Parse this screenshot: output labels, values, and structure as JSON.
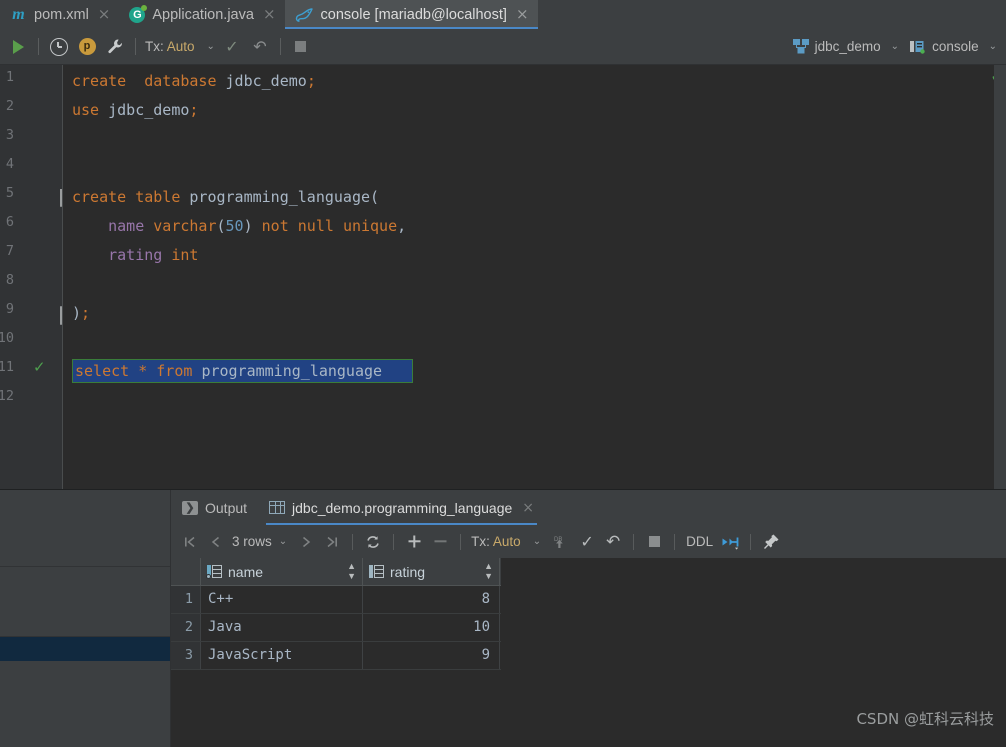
{
  "tabs": [
    {
      "label": "pom.xml",
      "icon": "maven-icon",
      "active": false,
      "close": "×"
    },
    {
      "label": "Application.java",
      "icon": "spring-boot-icon",
      "active": false,
      "close": "×"
    },
    {
      "label": "console [mariadb@localhost]",
      "icon": "mariadb-dolphin-icon",
      "active": true,
      "close": "×"
    }
  ],
  "toolbar": {
    "run_icon": "run-play-icon",
    "history_icon": "clock-history-icon",
    "profile_icon": "parameters-badge-icon",
    "settings_icon": "wrench-icon",
    "tx_prefix": "Tx:",
    "tx_value": "Auto",
    "tx_chevron": "⌄",
    "commit_icon": "commit-check-icon",
    "rollback_icon": "rollback-arrow-icon",
    "stop_icon": "stop-square-icon",
    "datasource": "jdbc_demo",
    "datasource_icon": "database-schema-icon",
    "datasource_chevron": "⌄",
    "session": "console",
    "session_icon": "console-session-icon",
    "session_chevron": "⌄"
  },
  "editor": {
    "right_marker_icon": "inspection-ok-check-icon",
    "line_numbers": [
      "1",
      "2",
      "3",
      "4",
      "5",
      "6",
      "7",
      "8",
      "9",
      "10",
      "11",
      "12"
    ],
    "gutter_check_icon": "statement-ok-check-icon",
    "lines": [
      {
        "n": 1,
        "segments": [
          {
            "t": "create",
            "c": "kw"
          },
          {
            "t": "  ",
            "c": "punc"
          },
          {
            "t": "database",
            "c": "kw"
          },
          {
            "t": " ",
            "c": "punc"
          },
          {
            "t": "jdbc_demo",
            "c": "ident"
          },
          {
            "t": ";",
            "c": "kw"
          }
        ]
      },
      {
        "n": 2,
        "segments": [
          {
            "t": "use",
            "c": "kw"
          },
          {
            "t": " ",
            "c": "punc"
          },
          {
            "t": "jdbc_demo",
            "c": "ident"
          },
          {
            "t": ";",
            "c": "kw"
          }
        ]
      },
      {
        "n": 3,
        "segments": []
      },
      {
        "n": 4,
        "segments": []
      },
      {
        "n": 5,
        "segments": [
          {
            "t": "create",
            "c": "kw"
          },
          {
            "t": " ",
            "c": "punc"
          },
          {
            "t": "table",
            "c": "kw"
          },
          {
            "t": " ",
            "c": "punc"
          },
          {
            "t": "programming_language",
            "c": "ident"
          },
          {
            "t": "(",
            "c": "punc"
          }
        ]
      },
      {
        "n": 6,
        "segments": [
          {
            "t": "    ",
            "c": "punc"
          },
          {
            "t": "name",
            "c": "fld"
          },
          {
            "t": " ",
            "c": "punc"
          },
          {
            "t": "varchar",
            "c": "kw"
          },
          {
            "t": "(",
            "c": "punc"
          },
          {
            "t": "50",
            "c": "num"
          },
          {
            "t": ")",
            "c": "punc"
          },
          {
            "t": " ",
            "c": "punc"
          },
          {
            "t": "not",
            "c": "kw"
          },
          {
            "t": " ",
            "c": "punc"
          },
          {
            "t": "null",
            "c": "kw"
          },
          {
            "t": " ",
            "c": "punc"
          },
          {
            "t": "unique",
            "c": "kw"
          },
          {
            "t": ",",
            "c": "punc"
          }
        ]
      },
      {
        "n": 7,
        "segments": [
          {
            "t": "    ",
            "c": "punc"
          },
          {
            "t": "rating",
            "c": "fld"
          },
          {
            "t": " ",
            "c": "punc"
          },
          {
            "t": "int",
            "c": "kw"
          }
        ]
      },
      {
        "n": 8,
        "segments": []
      },
      {
        "n": 9,
        "segments": [
          {
            "t": ")",
            "c": "punc"
          },
          {
            "t": ";",
            "c": "kw"
          }
        ]
      },
      {
        "n": 10,
        "segments": []
      },
      {
        "n": 11,
        "segments": []
      },
      {
        "n": 12,
        "segments": []
      }
    ],
    "selected_statement": [
      {
        "t": "select",
        "c": "kw"
      },
      {
        "t": " ",
        "c": "punc"
      },
      {
        "t": "*",
        "c": "kw"
      },
      {
        "t": " ",
        "c": "punc"
      },
      {
        "t": "from",
        "c": "kw"
      },
      {
        "t": " ",
        "c": "punc"
      },
      {
        "t": "programming_language",
        "c": "ident"
      }
    ],
    "fold_markers": [
      {
        "line": 5,
        "type": "fold-expanded-open"
      },
      {
        "line": 9,
        "type": "fold-expanded-close"
      }
    ]
  },
  "results": {
    "tabs": [
      {
        "label": "Output",
        "icon": "output-console-icon",
        "active": false,
        "closable": false
      },
      {
        "label": "jdbc_demo.programming_language",
        "icon": "result-grid-icon",
        "active": true,
        "closable": true,
        "close": "×"
      }
    ],
    "toolbar": {
      "first_page_icon": "first-page-icon",
      "prev_page_icon": "prev-page-icon",
      "rows_label": "3 rows",
      "rows_chevron": "⌄",
      "next_page_icon": "next-page-icon",
      "last_page_icon": "last-page-icon",
      "reload_icon": "refresh-icon",
      "add_row_icon": "add-row-icon",
      "delete_row_icon": "delete-row-icon",
      "tx_prefix": "Tx:",
      "tx_value": "Auto",
      "tx_chevron": "⌄",
      "db_upload_icon": "db-submit-icon",
      "commit_icon": "commit-check-icon",
      "rollback_icon": "rollback-arrow-icon",
      "stop_icon": "stop-square-icon",
      "ddl_label": "DDL",
      "export_icon": "export-data-icon",
      "pin_icon": "pin-tab-icon"
    },
    "grid": {
      "columns": [
        {
          "label": "name",
          "icon": "column-key-icon",
          "sort_icon": "sort-toggle-icon"
        },
        {
          "label": "rating",
          "icon": "column-icon",
          "sort_icon": "sort-toggle-icon"
        }
      ],
      "rows": [
        {
          "num": "1",
          "name": "C++",
          "rating": "8"
        },
        {
          "num": "2",
          "name": "Java",
          "rating": "10"
        },
        {
          "num": "3",
          "name": "JavaScript",
          "rating": "9"
        }
      ]
    }
  },
  "watermark": "CSDN @虹科云科技",
  "colors": {
    "editor_bg": "#2b2b2b",
    "panel_bg": "#3c3f41",
    "gutter_bg": "#313335",
    "accent_blue": "#4a88c7",
    "selection_blue": "#214283",
    "keyword_orange": "#cc7832",
    "text_gray": "#a9b7c6",
    "number_blue": "#6897bb",
    "field_purple": "#9876aa",
    "ok_green": "#4d9e4d",
    "navy_strip": "#11293f"
  }
}
